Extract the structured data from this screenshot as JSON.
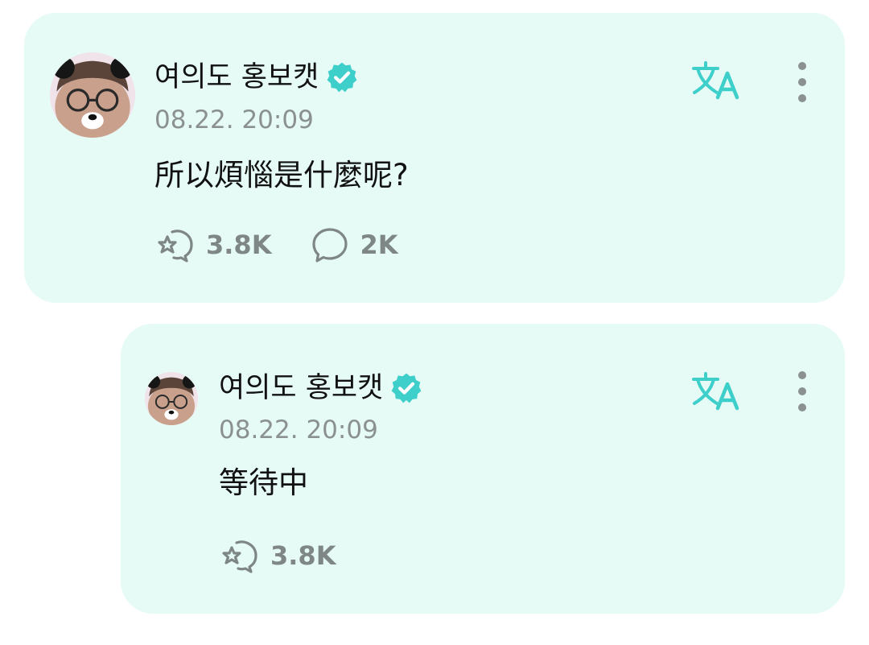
{
  "colors": {
    "card_background": "#e6fbf6",
    "accent": "#3fcfcb",
    "muted_text": "#8a9190",
    "count_text": "#7e8786"
  },
  "post": {
    "author": "여의도 홍보캣",
    "verified_icon": "verified-badge-icon",
    "timestamp": "08.22. 20:09",
    "text": "所以煩惱是什麼呢?",
    "translate_icon": "translate-icon",
    "more_icon": "more-vertical-icon",
    "reactions": {
      "icon": "reaction-sticker-icon",
      "count": "3.8K"
    },
    "comments": {
      "icon": "comment-bubble-icon",
      "count": "2K"
    }
  },
  "reply": {
    "author": "여의도 홍보캣",
    "verified_icon": "verified-badge-icon",
    "timestamp": "08.22. 20:09",
    "text": "等待中",
    "translate_icon": "translate-icon",
    "more_icon": "more-vertical-icon",
    "reactions": {
      "icon": "reaction-sticker-icon",
      "count": "3.8K"
    }
  }
}
